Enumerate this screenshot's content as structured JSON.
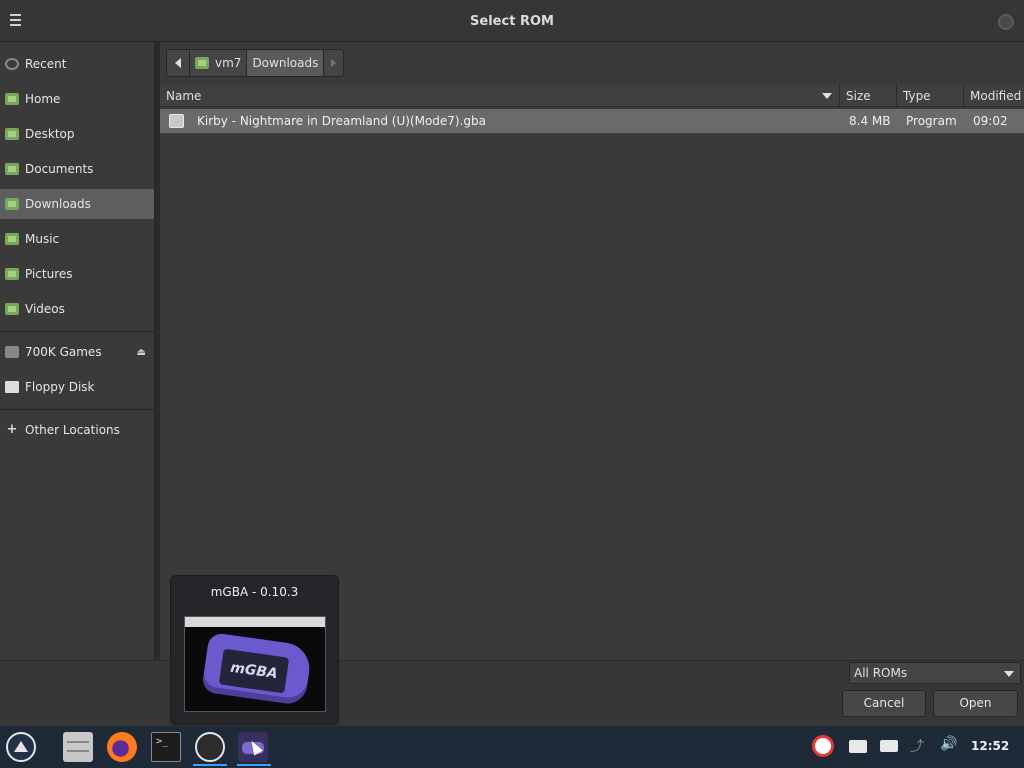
{
  "window": {
    "title": "Select ROM"
  },
  "sidebar": {
    "items": [
      {
        "label": "Recent",
        "icon": "clock-icon"
      },
      {
        "label": "Home",
        "icon": "folder-home-icon"
      },
      {
        "label": "Desktop",
        "icon": "folder-desktop-icon"
      },
      {
        "label": "Documents",
        "icon": "folder-documents-icon"
      },
      {
        "label": "Downloads",
        "icon": "folder-downloads-icon",
        "active": true
      },
      {
        "label": "Music",
        "icon": "folder-music-icon"
      },
      {
        "label": "Pictures",
        "icon": "folder-pictures-icon"
      },
      {
        "label": "Videos",
        "icon": "folder-videos-icon"
      }
    ],
    "devices": [
      {
        "label": "700K Games",
        "icon": "drive-icon",
        "ejectable": true
      },
      {
        "label": "Floppy Disk",
        "icon": "floppy-icon"
      }
    ],
    "other": {
      "label": "Other Locations",
      "icon": "plus-icon"
    }
  },
  "pathbar": {
    "home": "vm7",
    "current": "Downloads"
  },
  "columns": {
    "name": "Name",
    "size": "Size",
    "type": "Type",
    "modified": "Modified"
  },
  "files": [
    {
      "name": "Kirby - Nightmare in Dreamland (U)(Mode7).gba",
      "size": "8.4 MB",
      "type": "Program",
      "modified": "09:02"
    }
  ],
  "filter": {
    "selected": "All ROMs"
  },
  "buttons": {
    "cancel": "Cancel",
    "open": "Open"
  },
  "preview": {
    "title": "mGBA - 0.10.3",
    "logo": "mGBA"
  },
  "taskbar": {
    "clock": "12:52",
    "terminal_glyph": ">_"
  }
}
